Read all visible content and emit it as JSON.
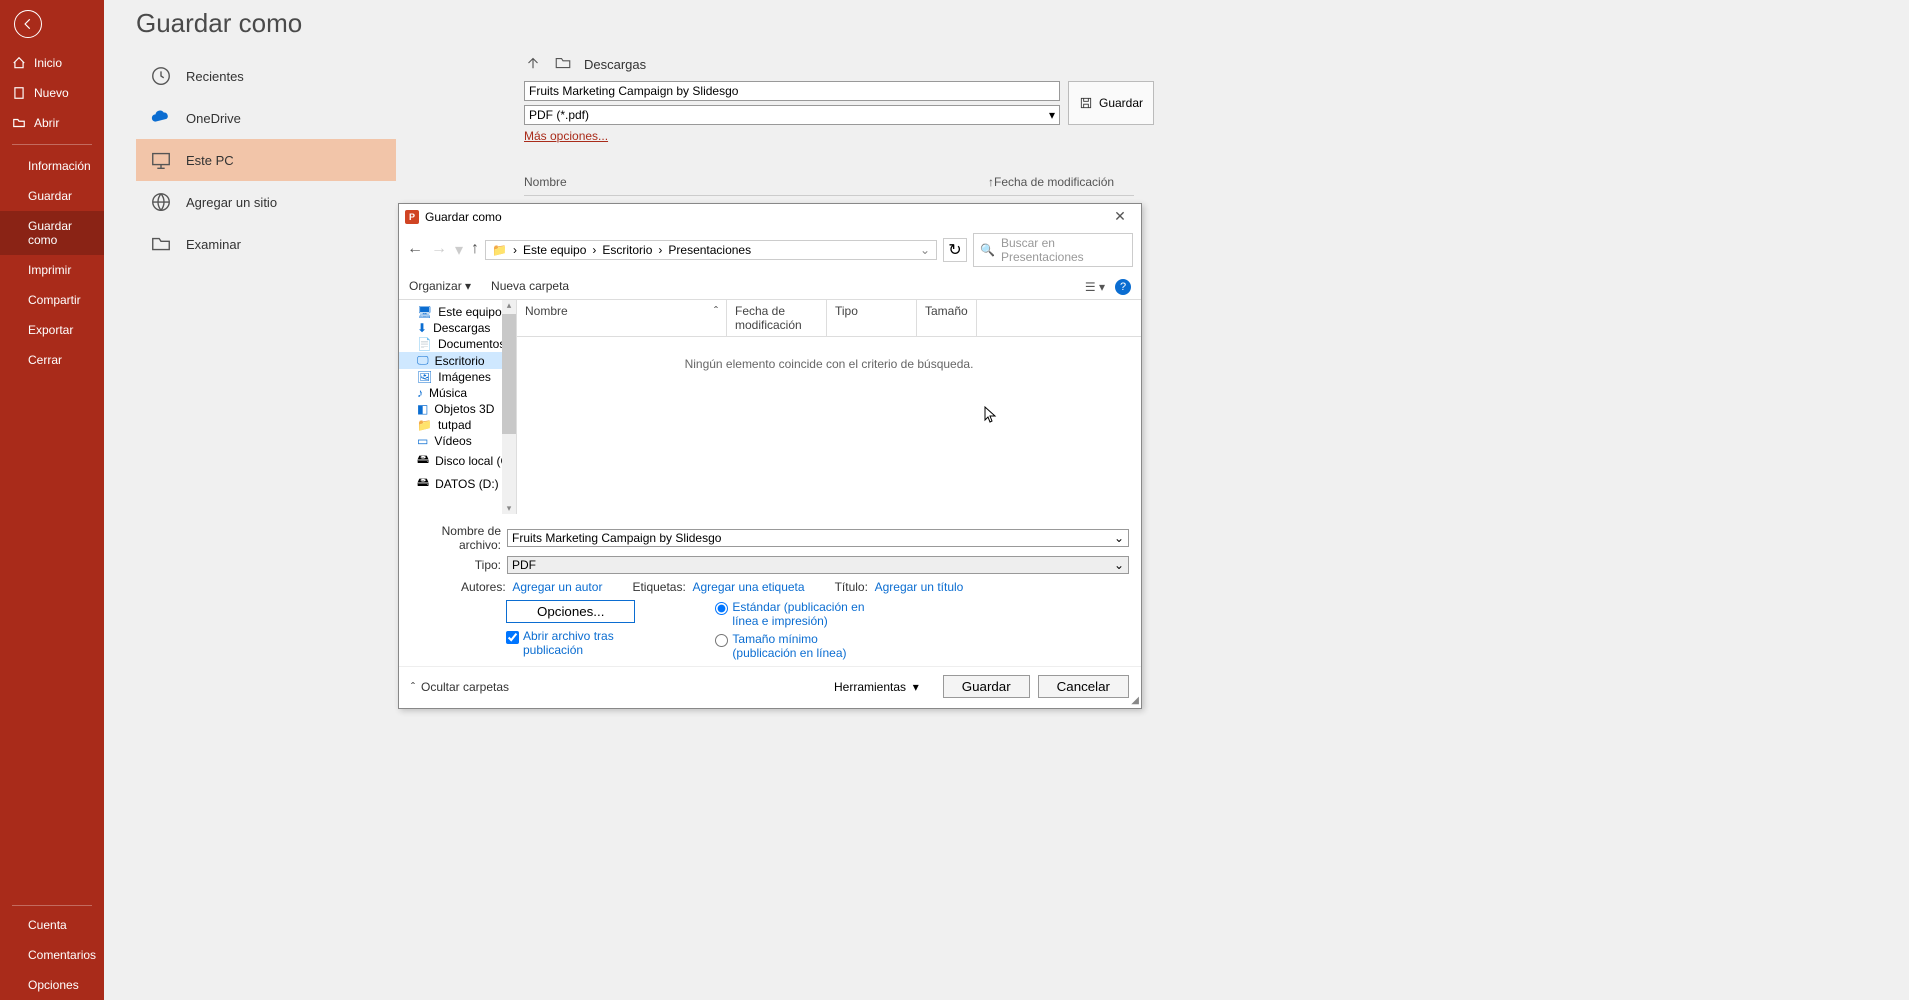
{
  "page": {
    "title": "Guardar como"
  },
  "sidebar": {
    "back": "←",
    "items": [
      {
        "label": "Inicio"
      },
      {
        "label": "Nuevo"
      },
      {
        "label": "Abrir"
      },
      {
        "label": "Información"
      },
      {
        "label": "Guardar"
      },
      {
        "label": "Guardar como"
      },
      {
        "label": "Imprimir"
      },
      {
        "label": "Compartir"
      },
      {
        "label": "Exportar"
      },
      {
        "label": "Cerrar"
      }
    ],
    "bottom": [
      {
        "label": "Cuenta"
      },
      {
        "label": "Comentarios"
      },
      {
        "label": "Opciones"
      }
    ]
  },
  "locations": [
    {
      "label": "Recientes"
    },
    {
      "label": "OneDrive"
    },
    {
      "label": "Este PC"
    },
    {
      "label": "Agregar un sitio"
    },
    {
      "label": "Examinar"
    }
  ],
  "savepanel": {
    "folder": "Descargas",
    "filename": "Fruits Marketing Campaign by Slidesgo",
    "filetype": "PDF (*.pdf)",
    "save": "Guardar",
    "more": "Más opciones...",
    "col_name": "Nombre",
    "col_date": "Fecha de modificación"
  },
  "dialog": {
    "title": "Guardar como",
    "breadcrumb": [
      "Este equipo",
      "Escritorio",
      "Presentaciones"
    ],
    "search_placeholder": "Buscar en Presentaciones",
    "organize": "Organizar",
    "newfolder": "Nueva carpeta",
    "tree": [
      "Este equipo",
      "Descargas",
      "Documentos",
      "Escritorio",
      "Imágenes",
      "Música",
      "Objetos 3D",
      "tutpad",
      "Vídeos",
      "Disco local (C:)",
      "DATOS (D:)"
    ],
    "list_headers": {
      "name": "Nombre",
      "date": "Fecha de modificación",
      "type": "Tipo",
      "size": "Tamaño"
    },
    "empty": "Ningún elemento coincide con el criterio de búsqueda.",
    "filename_label": "Nombre de archivo:",
    "filename": "Fruits Marketing Campaign by Slidesgo",
    "type_label": "Tipo:",
    "type": "PDF",
    "authors_label": "Autores:",
    "authors_add": "Agregar un autor",
    "tags_label": "Etiquetas:",
    "tags_add": "Agregar una etiqueta",
    "title_label": "Título:",
    "title_add": "Agregar un título",
    "options_btn": "Opciones...",
    "open_after": "Abrir archivo tras publicación",
    "radio_std": "Estándar (publicación en línea e impresión)",
    "radio_min": "Tamaño mínimo (publicación en línea)",
    "hide_folders": "Ocultar carpetas",
    "tools": "Herramientas",
    "save": "Guardar",
    "cancel": "Cancelar"
  }
}
